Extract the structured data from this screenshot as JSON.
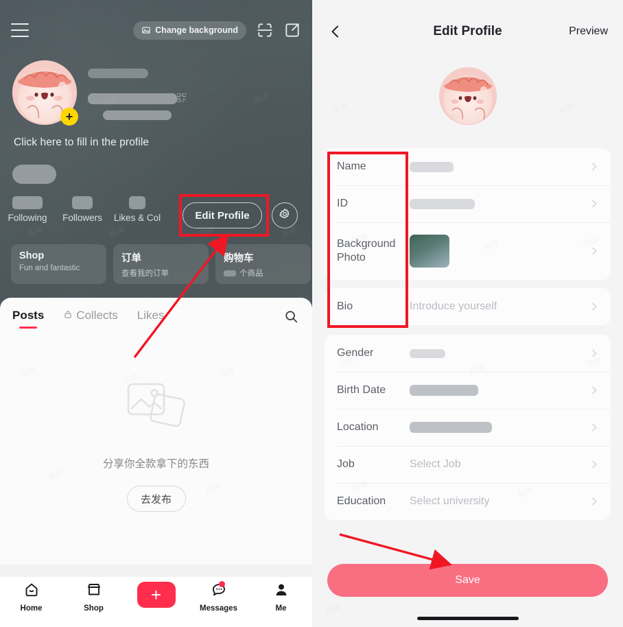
{
  "left_phone": {
    "topbar": {
      "menu_icon": "hamburger-menu-icon",
      "change_background_label": "Change background",
      "change_background_icon": "image-icon",
      "scan_icon": "scan-qr-icon",
      "share_icon": "share-external-icon"
    },
    "avatar": {
      "icon": "avatar-cartoon-pink-character",
      "add_badge": "+"
    },
    "profile": {
      "name_placeholder_redacted": true,
      "id_placeholder_redacted": true,
      "qr_icon": "qr-code-icon",
      "fill_profile_prompt": "Click here to fill in the profile"
    },
    "stats": [
      {
        "label": "Following",
        "value_redacted": true
      },
      {
        "label": "Followers",
        "value_redacted": true
      },
      {
        "label": "Likes & Col",
        "value_redacted": true
      }
    ],
    "actions": {
      "edit_profile_label": "Edit Profile",
      "settings_icon": "gear-icon"
    },
    "shop_cards": [
      {
        "title": "Shop",
        "subtitle": "Fun and fantastic"
      },
      {
        "title": "订单",
        "subtitle": "查看我的订单"
      },
      {
        "title": "购物车",
        "subtitle": "个商品",
        "subtitle_has_redacted_count": true
      }
    ],
    "tabs": [
      {
        "label": "Posts",
        "active": true,
        "icon": null
      },
      {
        "label": "Collects",
        "active": false,
        "icon": "lock-icon"
      },
      {
        "label": "Likes",
        "active": false,
        "icon": null
      }
    ],
    "search_icon": "search-icon",
    "empty_state": {
      "art_icon": "photos-stack-icon",
      "text": "分享你全款拿下的东西",
      "button_label": "去发布"
    },
    "bottom_nav": [
      {
        "label": "Home",
        "icon": "home-icon"
      },
      {
        "label": "Shop",
        "icon": "storefront-icon"
      },
      {
        "label": "",
        "icon": "plus-create-icon"
      },
      {
        "label": "Messages",
        "icon": "chat-bubble-icon",
        "badge": true
      },
      {
        "label": "Me",
        "icon": "person-icon"
      }
    ]
  },
  "right_phone": {
    "header": {
      "back_icon": "back-chevron-icon",
      "title": "Edit Profile",
      "preview_label": "Preview"
    },
    "avatar_icon": "avatar-cartoon-pink-character",
    "card_primary": [
      {
        "label": "Name",
        "value": "",
        "value_redacted": true,
        "chevron": "chevron-right-icon"
      },
      {
        "label": "ID",
        "value": "",
        "value_redacted": true,
        "chevron": "chevron-right-icon"
      },
      {
        "label": "Background Photo",
        "value": "",
        "thumbnail": "background-photo-thumbnail",
        "chevron": "chevron-right-icon"
      }
    ],
    "card_bio": [
      {
        "label": "Bio",
        "value": "Introduce yourself",
        "placeholder": true,
        "chevron": "chevron-right-icon"
      }
    ],
    "card_details": [
      {
        "label": "Gender",
        "value": "",
        "value_redacted": true,
        "chevron": "chevron-right-icon"
      },
      {
        "label": "Birth Date",
        "value": "",
        "value_redacted": true,
        "chevron": "chevron-right-icon"
      },
      {
        "label": "Location",
        "value": "",
        "value_redacted": true,
        "chevron": "chevron-right-icon"
      },
      {
        "label": "Job",
        "value": "Select Job",
        "placeholder": true,
        "chevron": "chevron-right-icon"
      },
      {
        "label": "Education",
        "value": "Select university",
        "placeholder": true,
        "chevron": "chevron-right-icon"
      }
    ],
    "save_label": "Save"
  },
  "annotations": {
    "color": "#f01723",
    "box_edit_profile": "highlight-edit-profile-button",
    "box_profile_fields": "highlight-profile-fields",
    "arrow_to_edit_profile": "arrow-pointing-to-edit-profile",
    "arrow_to_save": "arrow-pointing-to-save-button"
  },
  "colors": {
    "accent_red": "#ff2e4d",
    "save_pink": "#f96e81",
    "hero_dark": "#4e585c",
    "annotation_red": "#f01723",
    "badge_yellow": "#ffd600"
  }
}
